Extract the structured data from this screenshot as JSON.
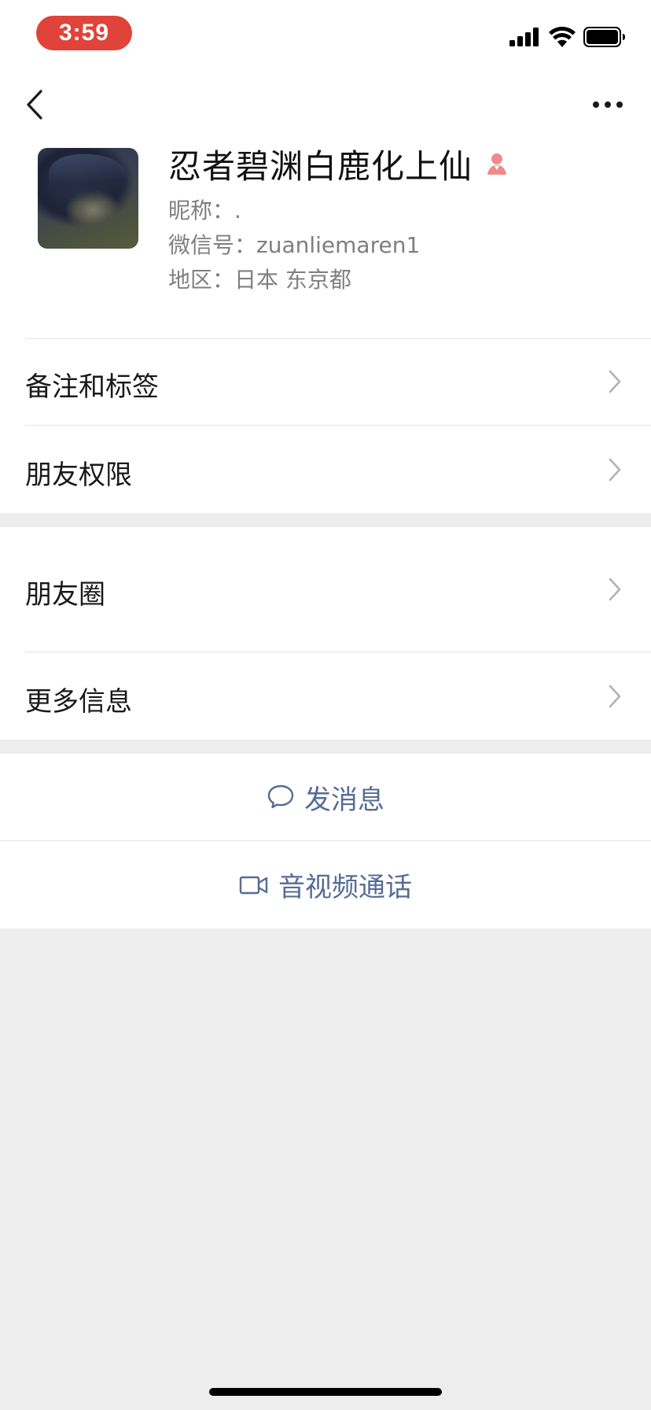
{
  "status_bar": {
    "time": "3:59",
    "icons": [
      "signal-icon",
      "wifi-icon",
      "battery-icon"
    ]
  },
  "nav": {
    "back_icon": "chevron-left-icon",
    "more_icon": "ellipsis-icon"
  },
  "profile": {
    "display_name": "忍者碧渊白鹿化上仙",
    "gender_icon": "female-icon",
    "gender_color": "#f08a8a",
    "nickname_label": "昵称：",
    "nickname_value": ".",
    "wechat_id_label": "微信号：",
    "wechat_id_value": "zuanliemaren1",
    "region_label": "地区：",
    "region_value": "日本 东京都"
  },
  "menu": {
    "remarks_tags": "备注和标签",
    "friend_permissions": "朋友权限",
    "moments": "朋友圈",
    "more_info": "更多信息"
  },
  "actions": {
    "send_message": "发消息",
    "video_call": "音视频通话"
  },
  "colors": {
    "link_blue": "#576b95",
    "background": "#ededed",
    "status_pill": "#e0433a"
  }
}
